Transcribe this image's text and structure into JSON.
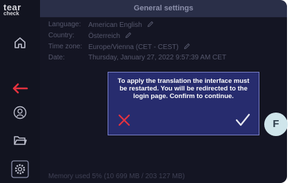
{
  "logo": {
    "line1": "tear",
    "line2": "check"
  },
  "header": {
    "title": "General settings"
  },
  "settings": [
    {
      "label": "Language:",
      "value": "American English",
      "editable": true
    },
    {
      "label": "Country:",
      "value": "Österreich",
      "editable": true
    },
    {
      "label": "Time zone:",
      "value": "Europe/Vienna (CET - CEST)",
      "editable": true
    },
    {
      "label": "Date:",
      "value": "Thursday, January 27, 2022 9:57:39 AM CET",
      "editable": false
    }
  ],
  "footer": {
    "memory": "Memory used 5% (10 699 MB / 203 127 MB)"
  },
  "dialog": {
    "message": "To apply the translation the interface must be restarted. You will be redirected to the login page. Confirm to continue."
  },
  "badge": {
    "label": "F"
  },
  "colors": {
    "accent_red": "#e5323f",
    "dialog_bg": "#272c6e",
    "badge_bg": "#cfe5eb"
  },
  "sidebar_icons": [
    "home-icon",
    "back-arrow-icon",
    "user-icon",
    "folder-icon",
    "settings-icon"
  ]
}
